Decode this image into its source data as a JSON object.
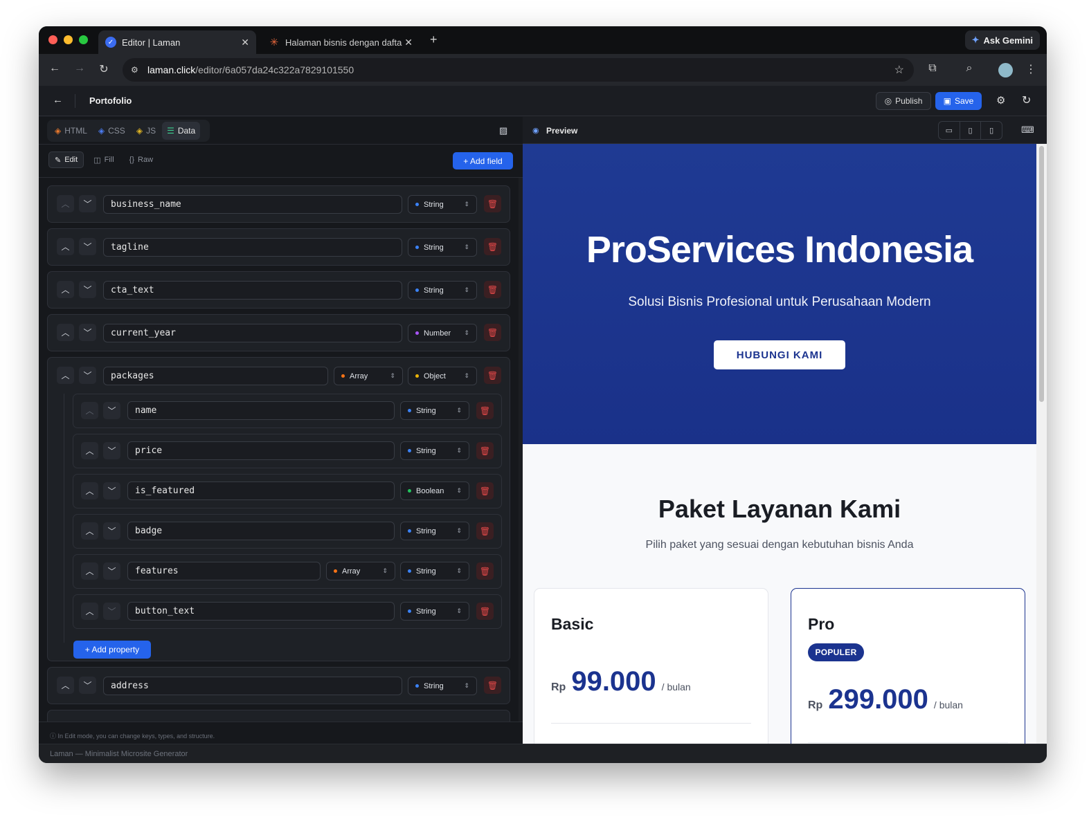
{
  "browser": {
    "tabs": [
      {
        "title": "Editor | Laman",
        "active": true
      },
      {
        "title": "Halaman bisnis dengan dafta",
        "active": false
      }
    ],
    "new_tab": "+",
    "gemini": "Ask Gemini",
    "url_host": "laman.click",
    "url_path": "/editor/6a057da24c322a7829101550"
  },
  "app": {
    "title": "Portofolio",
    "publish": "Publish",
    "save": "Save"
  },
  "editor": {
    "file_tabs": [
      "HTML",
      "CSS",
      "JS",
      "Data"
    ],
    "modes": [
      "Edit",
      "Fill",
      "Raw"
    ],
    "add_field": "+ Add field",
    "fields": [
      {
        "key": "business_name",
        "type": "String"
      },
      {
        "key": "tagline",
        "type": "String"
      },
      {
        "key": "cta_text",
        "type": "String"
      },
      {
        "key": "current_year",
        "type": "Number"
      },
      {
        "key": "packages",
        "type": "Array",
        "item_type": "Object"
      }
    ],
    "properties": [
      {
        "key": "name",
        "type": "String"
      },
      {
        "key": "price",
        "type": "String"
      },
      {
        "key": "is_featured",
        "type": "Boolean"
      },
      {
        "key": "badge",
        "type": "String"
      },
      {
        "key": "features",
        "type": "Array",
        "item_type": "String"
      },
      {
        "key": "button_text",
        "type": "String"
      }
    ],
    "add_property": "+ Add property",
    "after_fields": [
      {
        "key": "address",
        "type": "String"
      }
    ],
    "hint": "In Edit mode, you can change keys, types, and structure.",
    "footer": "Laman — Minimalist Microsite Generator"
  },
  "preview": {
    "label": "Preview",
    "hero_title": "ProServices Indonesia",
    "hero_tagline": "Solusi Bisnis Profesional untuk Perusahaan Modern",
    "cta": "HUBUNGI KAMI",
    "section_title": "Paket Layanan Kami",
    "section_sub": "Pilih paket yang sesuai dengan kebutuhan bisnis Anda",
    "packages": [
      {
        "name": "Basic",
        "currency": "Rp",
        "price": "99.000",
        "period": "/ bulan"
      },
      {
        "name": "Pro",
        "badge": "POPULER",
        "currency": "Rp",
        "price": "299.000",
        "period": "/ bulan"
      }
    ]
  },
  "colors": {
    "accent": "#2563eb",
    "hero": "#1f3a93",
    "danger": "#e04848",
    "type_string": "#3b82f6",
    "type_number": "#a855f7",
    "type_array": "#f97316",
    "type_object": "#eab308",
    "type_boolean": "#22c55e"
  }
}
